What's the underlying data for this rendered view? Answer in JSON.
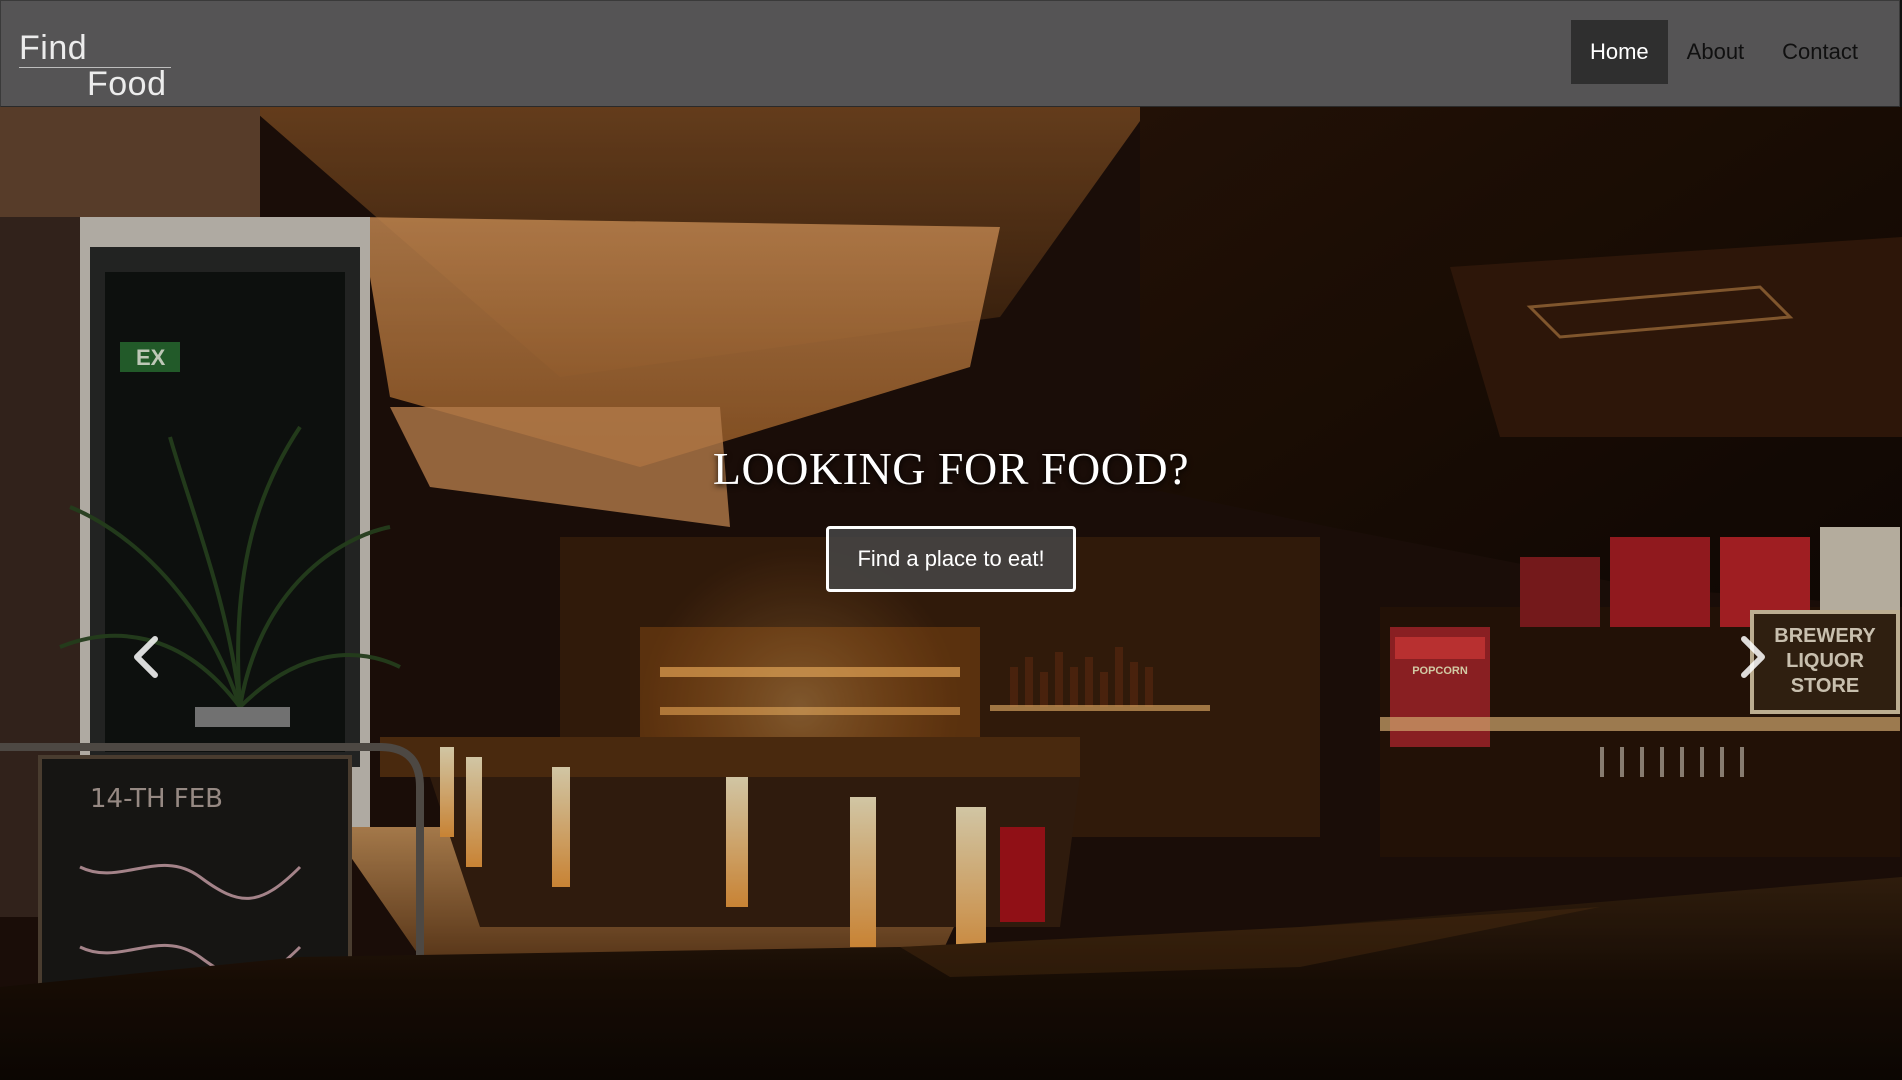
{
  "brand": {
    "line1": "Find",
    "line2": "Food"
  },
  "nav": {
    "items": [
      {
        "label": "Home",
        "active": true
      },
      {
        "label": "About",
        "active": false
      },
      {
        "label": "Contact",
        "active": false
      }
    ]
  },
  "hero": {
    "title": "LOOKING FOR FOOD?",
    "cta_label": "Find a place to eat!",
    "prev_icon": "chevron-left-icon",
    "next_icon": "chevron-right-icon"
  },
  "scene": {
    "chalkboard": "14-TH FEB",
    "liquor_sign_line1": "BREWERY",
    "liquor_sign_line2": "LIQUOR",
    "liquor_sign_line3": "STORE",
    "popcorn_sign": "POPCORN",
    "exit_sign": "EX"
  },
  "colors": {
    "navbar": "#555455",
    "nav_active": "#2f2f2f",
    "cta_border": "#ffffff",
    "warm_light": "#f2a24a"
  }
}
